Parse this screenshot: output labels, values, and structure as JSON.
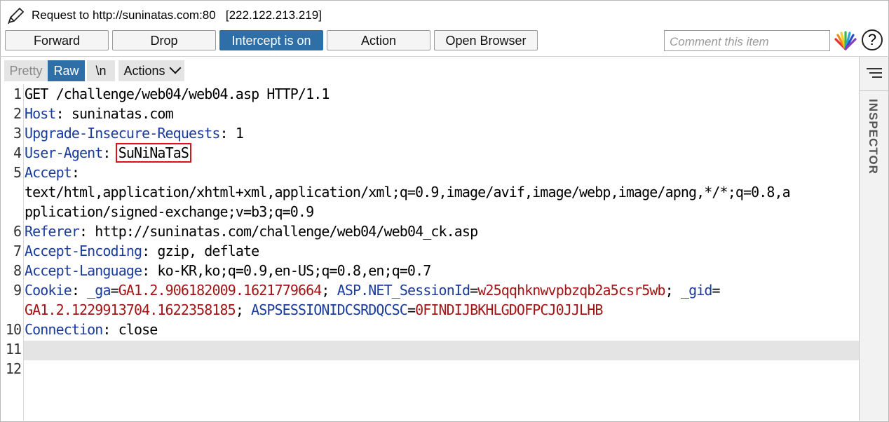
{
  "window": {
    "title": "Request to http://suninatas.com:80   [222.122.213.219]"
  },
  "toolbar": {
    "forward": "Forward",
    "drop": "Drop",
    "intercept": "Intercept is on",
    "action": "Action",
    "open_browser": "Open Browser",
    "comment_placeholder": "Comment this item",
    "help": "?"
  },
  "tabs": {
    "pretty": "Pretty",
    "raw": "Raw",
    "newline": "\\n",
    "actions": "Actions"
  },
  "inspector": {
    "label": "INSPECTOR"
  },
  "request": {
    "line_numbers": [
      "1",
      "2",
      "3",
      "4",
      "5",
      "6",
      "7",
      "8",
      "9",
      "10",
      "11",
      "12"
    ],
    "l1": "GET /challenge/web04/web04.asp HTTP/1.1",
    "l2_key": "Host",
    "l2_val": " suninatas.com",
    "l3_key": "Upgrade-Insecure-Requests",
    "l3_val": " 1",
    "l4_key": "User-Agent",
    "l4_val": "SuNiNaTaS",
    "l5_key": "Accept",
    "l5_sep": ":",
    "l5_cont1": "text/html,application/xhtml+xml,application/xml;q=0.9,image/avif,image/webp,image/apng,*/*;q=0.8,a",
    "l5_cont2": "pplication/signed-exchange;v=b3;q=0.9",
    "l6_key": "Referer",
    "l6_val": " http://suninatas.com/challenge/web04/web04_ck.asp",
    "l7_key": "Accept-Encoding",
    "l7_val": " gzip, deflate",
    "l8_key": "Accept-Language",
    "l8_val": " ko-KR,ko;q=0.9,en-US;q=0.8,en;q=0.7",
    "l9_key": "Cookie",
    "c1_name": " _ga",
    "c1_val": "GA1.2.906182009.1621779664",
    "c2_name": " ASP.NET_SessionId",
    "c2_val": "w25qqhknwvpbzqb2a5csr5wb",
    "c3_name": " _gid",
    "c3_val": "GA1.2.1229913704.1622358185",
    "c4_name": " ASPSESSIONIDCSRDQCSC",
    "c4_val": "0FINDIJBKHLGDOFPCJ0JJLHB",
    "l10_key": "Connection",
    "l10_val": " close"
  }
}
